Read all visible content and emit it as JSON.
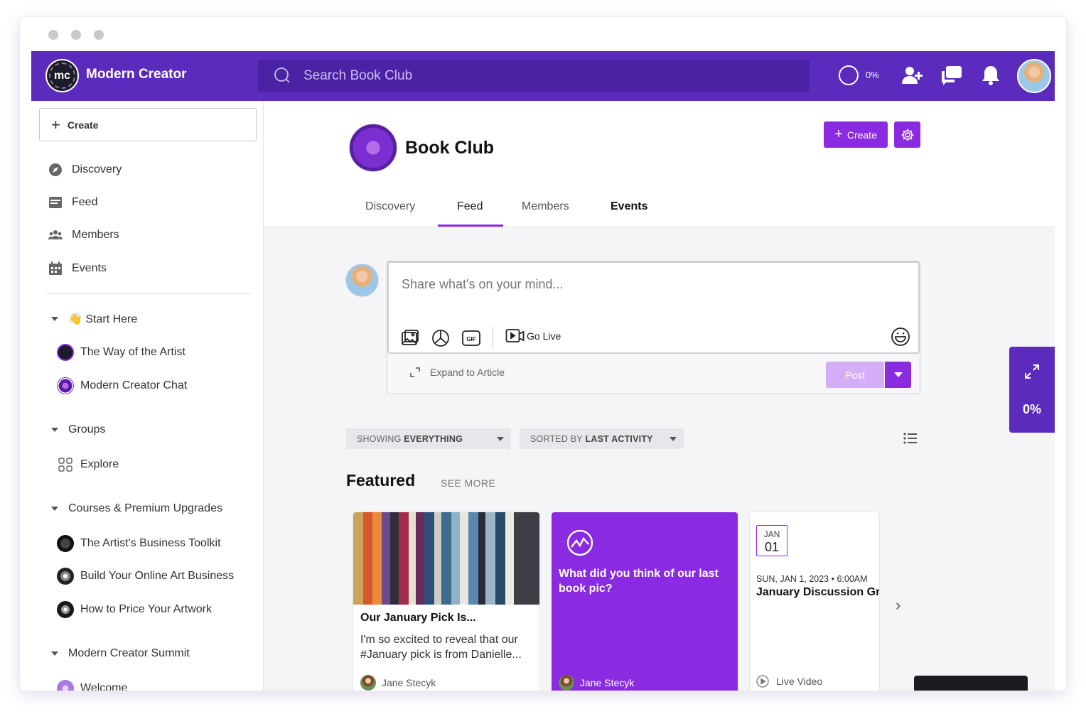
{
  "brand": {
    "name": "Modern Creator",
    "logo_text": "mc"
  },
  "search": {
    "placeholder": "Search Book Club"
  },
  "topnav": {
    "progress": "0%"
  },
  "sidebar": {
    "create_label": "Create",
    "nav": [
      {
        "label": "Discovery",
        "icon": "compass-icon"
      },
      {
        "label": "Feed",
        "icon": "feed-icon"
      },
      {
        "label": "Members",
        "icon": "members-icon"
      },
      {
        "label": "Events",
        "icon": "calendar-icon"
      }
    ],
    "sections": [
      {
        "label": "👋 Start Here",
        "items": [
          "The Way of the Artist",
          "Modern Creator Chat"
        ]
      },
      {
        "label": "Groups",
        "items": [
          "Explore"
        ]
      },
      {
        "label": "Courses & Premium Upgrades",
        "items": [
          "The Artist's Business Toolkit",
          "Build Your Online Art Business",
          "How to Price Your Artwork"
        ]
      },
      {
        "label": "Modern Creator Summit",
        "items": [
          "Welcome"
        ]
      }
    ]
  },
  "group": {
    "title": "Book Club",
    "create_label": "Create",
    "tabs": [
      "Discovery",
      "Feed",
      "Members",
      "Events"
    ]
  },
  "composer": {
    "placeholder": "Share what's on your mind...",
    "go_live": "Go Live",
    "expand": "Expand to Article",
    "post": "Post"
  },
  "filters": {
    "showing_prefix": "SHOWING",
    "showing_value": "EVERYTHING",
    "sorted_prefix": "SORTED BY",
    "sorted_value": "LAST ACTIVITY"
  },
  "featured": {
    "title": "Featured",
    "see_more": "SEE MORE",
    "cards": [
      {
        "title": "Our January Pick Is...",
        "body": "I'm so excited to reveal that our #January pick is from Danielle...",
        "author": "Jane Stecyk"
      },
      {
        "title": "What did you think of our last book pic?",
        "author": "Jane Stecyk"
      },
      {
        "month": "JAN",
        "day": "01",
        "date": "SUN, JAN 1, 2023 • 6:00AM",
        "title": "January Discussion Gr",
        "type": "Live Video"
      }
    ]
  },
  "float": {
    "progress": "0%"
  },
  "colors": {
    "primary": "#5a2bbd",
    "accent": "#8a2be2",
    "post_disabled": "#d6aef7"
  }
}
